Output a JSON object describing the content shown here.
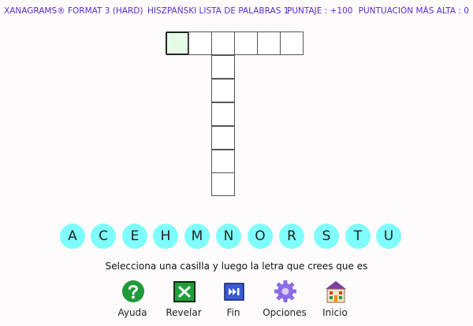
{
  "header": {
    "game_title": "XANAGRAMS® FORMAT 3 (HARD)",
    "word_list": "HISZPAŃSKI LISTA DE PALABRAS 1",
    "score": "PUNTAJE : +100",
    "high_score": "PUNTUACIÓN MÁS ALTA : 0"
  },
  "board": {
    "across_word_length": 6,
    "down_word_length": 7,
    "selected_cell": "across-1"
  },
  "letters": [
    "A",
    "C",
    "E",
    "H",
    "M",
    "N",
    "O",
    "R",
    "S",
    "T",
    "U"
  ],
  "instruction": "Selecciona una casilla y luego la letra que crees que es",
  "toolbar": {
    "help_label": "Ayuda",
    "reveal_label": "Revelar",
    "end_label": "Fin",
    "options_label": "Opciones",
    "home_label": "Inicio"
  },
  "colors": {
    "header_text": "#5b2ad0",
    "letter_tile": "#7ffdfd",
    "selected_cell": "#e6fbe6",
    "help_icon": "#1f9a3a",
    "reveal_icon": "#1fa13a",
    "end_icon": "#3a5bd6",
    "options_icon": "#8a6be6",
    "home_roof": "#7b3fa0"
  },
  "icons": {
    "help": "question-circle-icon",
    "reveal": "x-square-icon",
    "end": "fast-forward-icon",
    "options": "gear-icon",
    "home": "house-icon"
  }
}
